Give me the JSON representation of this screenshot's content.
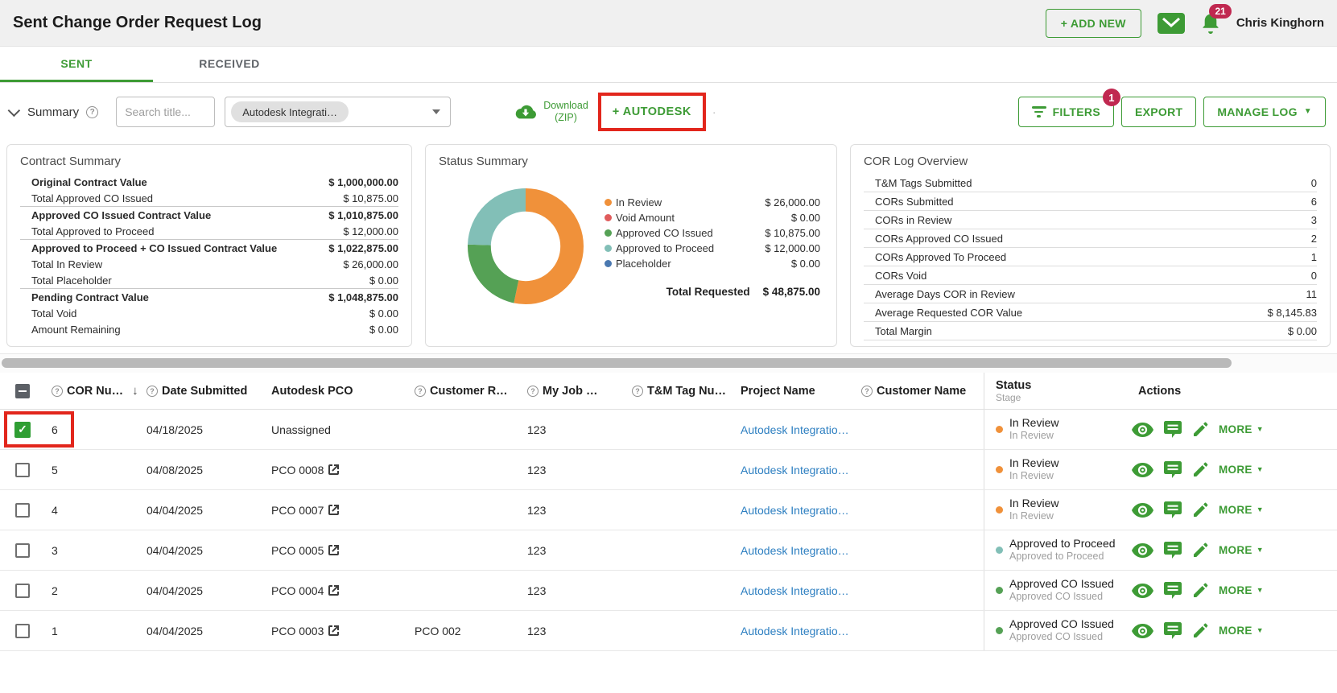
{
  "colors": {
    "accent_green": "#3d9b35",
    "annotation_red": "#e2261c",
    "badge_crimson": "#c02850",
    "link_blue": "#2d7fc1"
  },
  "icons": {
    "help": "?",
    "sort_desc": "↓",
    "caret_down": "▼",
    "check": "✓",
    "dot": "·"
  },
  "header": {
    "title": "Sent Change Order Request Log",
    "add_new": "+ ADD NEW",
    "notifications": "21",
    "user": "Chris Kinghorn"
  },
  "tabs": [
    {
      "label": "SENT"
    },
    {
      "label": "RECEIVED"
    }
  ],
  "toolbar": {
    "summary": "Summary",
    "search_placeholder": "Search title...",
    "project_filter_chip": "Autodesk Integrati…",
    "download_line1": "Download",
    "download_line2": "(ZIP)",
    "autodesk": "+ AUTODESK",
    "filters": "FILTERS",
    "filters_badge": "1",
    "export": "EXPORT",
    "manage_log": "MANAGE LOG"
  },
  "contract_summary": {
    "title": "Contract Summary",
    "rows": [
      {
        "label": "Original Contract Value",
        "value": "$ 1,000,000.00"
      },
      {
        "label": "Total Approved CO Issued",
        "value": "$ 10,875.00"
      },
      {
        "label": "Approved CO Issued Contract Value",
        "value": "$ 1,010,875.00"
      },
      {
        "label": "Total Approved to Proceed",
        "value": "$ 12,000.00"
      },
      {
        "label": "Approved to Proceed + CO Issued Contract Value",
        "value": "$ 1,022,875.00"
      },
      {
        "label": "Total In Review",
        "value": "$ 26,000.00"
      },
      {
        "label": "Total Placeholder",
        "value": "$ 0.00"
      },
      {
        "label": "Pending Contract Value",
        "value": "$ 1,048,875.00"
      },
      {
        "label": "Total Void",
        "value": "$ 0.00"
      },
      {
        "label": "Amount Remaining",
        "value": "$ 0.00"
      }
    ]
  },
  "status_summary": {
    "title": "Status Summary",
    "chart_data": {
      "type": "pie",
      "subtype": "donut",
      "title": "Status Summary",
      "categories": [
        "In Review",
        "Void Amount",
        "Approved CO Issued",
        "Approved to Proceed",
        "Placeholder"
      ],
      "values": [
        26000,
        0,
        10875,
        12000,
        0
      ],
      "value_labels": [
        "$ 26,000.00",
        "$ 0.00",
        "$ 10,875.00",
        "$ 12,000.00",
        "$ 0.00"
      ],
      "colors": [
        "#f0913a",
        "#e05c5c",
        "#55a155",
        "#82bfb7",
        "#4a78b0"
      ],
      "total_label": "Total Requested",
      "total_value": "$ 48,875.00",
      "legend_position": "right"
    }
  },
  "cor_log_overview": {
    "title": "COR Log Overview",
    "rows": [
      {
        "label": "T&M Tags Submitted",
        "value": "0"
      },
      {
        "label": "CORs Submitted",
        "value": "6"
      },
      {
        "label": "CORs in Review",
        "value": "3"
      },
      {
        "label": "CORs Approved CO Issued",
        "value": "2"
      },
      {
        "label": "CORs Approved To Proceed",
        "value": "1"
      },
      {
        "label": "CORs Void",
        "value": "0"
      },
      {
        "label": "Average Days COR in Review",
        "value": "11"
      },
      {
        "label": "Average Requested COR Value",
        "value": "$ 8,145.83"
      },
      {
        "label": "Total Margin",
        "value": "$ 0.00"
      }
    ]
  },
  "table": {
    "columns": {
      "cor_number": "COR Nu…",
      "date_submitted": "Date Submitted",
      "autodesk_pco": "Autodesk PCO",
      "customer_r": "Customer R…",
      "my_job": "My Job …",
      "tm_tag": "T&M Tag Nu…",
      "project_name": "Project Name",
      "customer_name": "Customer Name",
      "status": "Status",
      "stage": "Stage",
      "actions": "Actions"
    },
    "more_label": "MORE",
    "rows": [
      {
        "checked": true,
        "cor_number": "6",
        "date": "04/18/2025",
        "pco": "Unassigned",
        "pco_link": false,
        "customer_ref": "",
        "my_job": "123",
        "tm_tag": "",
        "project": "Autodesk Integratio…",
        "customer_name": "",
        "status": "In Review",
        "stage": "In Review",
        "status_color": "#f0913a"
      },
      {
        "checked": false,
        "cor_number": "5",
        "date": "04/08/2025",
        "pco": "PCO 0008",
        "pco_link": true,
        "customer_ref": "",
        "my_job": "123",
        "tm_tag": "",
        "project": "Autodesk Integratio…",
        "customer_name": "",
        "status": "In Review",
        "stage": "In Review",
        "status_color": "#f0913a"
      },
      {
        "checked": false,
        "cor_number": "4",
        "date": "04/04/2025",
        "pco": "PCO 0007",
        "pco_link": true,
        "customer_ref": "",
        "my_job": "123",
        "tm_tag": "",
        "project": "Autodesk Integratio…",
        "customer_name": "",
        "status": "In Review",
        "stage": "In Review",
        "status_color": "#f0913a"
      },
      {
        "checked": false,
        "cor_number": "3",
        "date": "04/04/2025",
        "pco": "PCO 0005",
        "pco_link": true,
        "customer_ref": "",
        "my_job": "123",
        "tm_tag": "",
        "project": "Autodesk Integratio…",
        "customer_name": "",
        "status": "Approved to Proceed",
        "stage": "Approved to Proceed",
        "status_color": "#82bfb7"
      },
      {
        "checked": false,
        "cor_number": "2",
        "date": "04/04/2025",
        "pco": "PCO 0004",
        "pco_link": true,
        "customer_ref": "",
        "my_job": "123",
        "tm_tag": "",
        "project": "Autodesk Integratio…",
        "customer_name": "",
        "status": "Approved CO Issued",
        "stage": "Approved CO Issued",
        "status_color": "#55a155"
      },
      {
        "checked": false,
        "cor_number": "1",
        "date": "04/04/2025",
        "pco": "PCO 0003",
        "pco_link": true,
        "customer_ref": "PCO 002",
        "my_job": "123",
        "tm_tag": "",
        "project": "Autodesk Integratio…",
        "customer_name": "",
        "status": "Approved CO Issued",
        "stage": "Approved CO Issued",
        "status_color": "#55a155"
      }
    ]
  }
}
